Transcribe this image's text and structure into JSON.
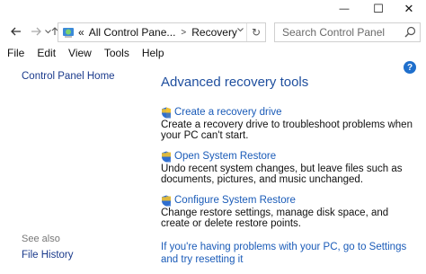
{
  "window": {
    "minimize_glyph": "—",
    "maximize_glyph": "☐",
    "close_glyph": "✕"
  },
  "nav": {
    "back_icon": "arrow-left-icon",
    "forward_icon": "arrow-right-icon",
    "recent_icon": "chevron-down-icon",
    "up_icon": "arrow-up-icon",
    "address": {
      "overflow": "«",
      "segments": [
        "All Control Pane...",
        "Recovery"
      ],
      "separator": ">"
    },
    "refresh_glyph": "↻",
    "search_placeholder": "Search Control Panel"
  },
  "menu": [
    "File",
    "Edit",
    "View",
    "Tools",
    "Help"
  ],
  "help_glyph": "?",
  "sidebar": {
    "home": "Control Panel Home",
    "see_also": "See also",
    "file_history": "File History"
  },
  "main": {
    "title": "Advanced recovery tools",
    "tools": [
      {
        "label": "Create a recovery drive",
        "desc": "Create a recovery drive to troubleshoot problems when your PC can't start."
      },
      {
        "label": "Open System Restore",
        "desc": "Undo recent system changes, but leave files such as documents, pictures, and music unchanged."
      },
      {
        "label": "Configure System Restore",
        "desc": "Change restore settings, manage disk space, and create or delete restore points."
      }
    ],
    "bottom_link": "If you're having problems with your PC, go to Settings and try resetting it"
  },
  "colors": {
    "link": "#1a5bb8",
    "title": "#1e4e9e",
    "help_badge": "#1f6fcc"
  }
}
